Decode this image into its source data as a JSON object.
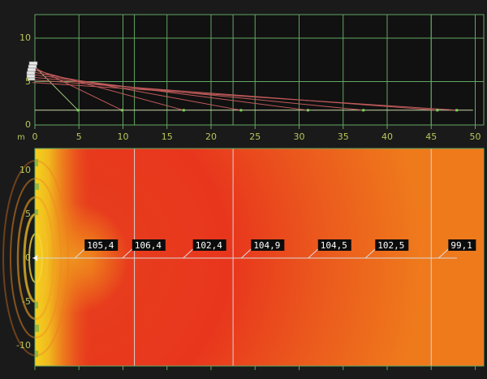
{
  "side_view": {
    "y_ticks": [
      "0",
      "5",
      "10"
    ],
    "x_ticks": [
      "0",
      "5",
      "10",
      "15",
      "20",
      "25",
      "30",
      "35",
      "40",
      "45",
      "50"
    ],
    "unit_label": "m",
    "target_points_m": [
      4.9,
      9.9,
      16.9,
      23.4,
      31.0,
      37.3,
      45.7,
      47.9
    ],
    "speaker_heights_m": [
      7.0,
      6.7,
      6.4,
      6.1,
      5.8,
      5.5,
      5.2,
      4.9
    ],
    "listener_height_m": 1.7
  },
  "spl_map": {
    "y_ticks": [
      "10",
      "5",
      "0",
      "-5",
      "-10"
    ],
    "section_lines_m": [
      11.3,
      22.5,
      45.0
    ],
    "labels": [
      {
        "value": "105,4",
        "x_m": 5.0
      },
      {
        "value": "106,4",
        "x_m": 10.4
      },
      {
        "value": "102,4",
        "x_m": 17.3
      },
      {
        "value": "104,9",
        "x_m": 23.9
      },
      {
        "value": "104,5",
        "x_m": 31.5
      },
      {
        "value": "102,5",
        "x_m": 38.0
      },
      {
        "value": "99,1",
        "x_m": 46.3
      }
    ]
  },
  "colors": {
    "background": "#1a1a1a",
    "grid": "#63a863",
    "axis_text": "#b9c65a",
    "ray": "#c05a5a",
    "spl_hot": "#e8301e",
    "spl_warm": "#ee6a1d",
    "spl_edge": "#f2c81d"
  }
}
